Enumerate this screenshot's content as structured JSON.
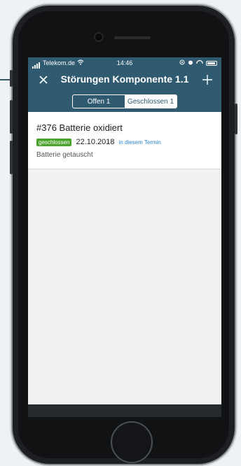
{
  "status_bar": {
    "carrier": "Telekom.de",
    "time": "14:46"
  },
  "nav": {
    "title": "Störungen Komponente 1.1"
  },
  "segments": [
    {
      "label": "Offen 1",
      "active": false
    },
    {
      "label": "Geschlossen 1",
      "active": true
    }
  ],
  "item": {
    "title": "#376 Batterie oxidiert",
    "badge": "geschlossen",
    "date": "22.10.2018",
    "link": "in diesem Termin",
    "description": "Batterie getauscht"
  },
  "colors": {
    "nav_bg": "#2f5a70",
    "badge_bg": "#4aa22a",
    "link": "#2f83c5"
  },
  "icons": {
    "close": "close-icon",
    "add": "plus-icon",
    "wifi": "wifi-icon",
    "battery": "battery-icon",
    "signal": "signal-icon"
  }
}
